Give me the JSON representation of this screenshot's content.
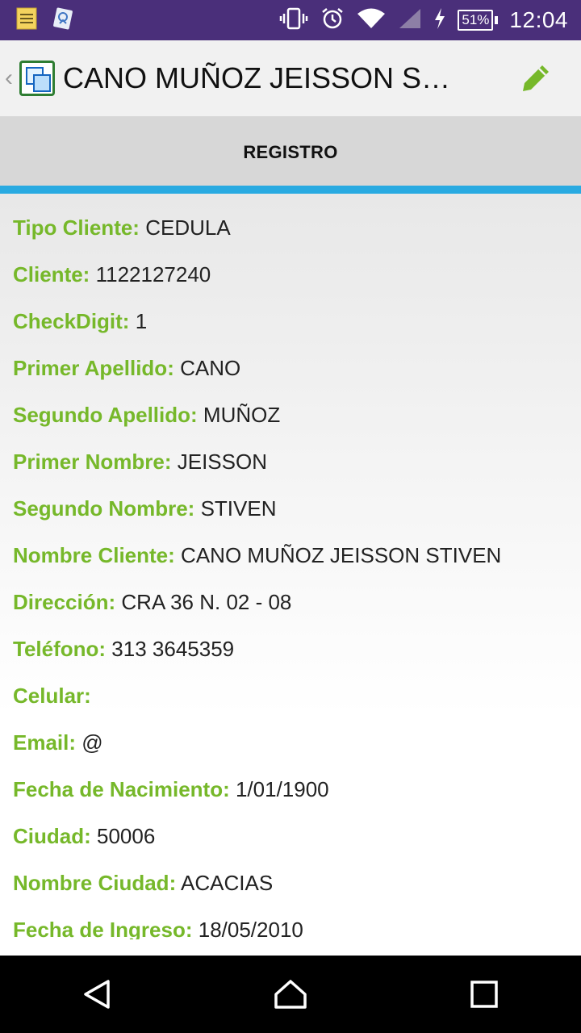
{
  "status_bar": {
    "battery": "51%",
    "time": "12:04",
    "icons": [
      "notes-icon",
      "gallery-icon",
      "vibrate-icon",
      "alarm-icon",
      "wifi-icon",
      "signal-icon",
      "charging-icon",
      "battery-icon"
    ]
  },
  "app_bar": {
    "back_symbol": "‹",
    "title": "CANO MUÑOZ JEISSON STIVEN",
    "edit_icon": "pencil-icon",
    "accent": "#76b82a"
  },
  "tab": {
    "label": "REGISTRO",
    "indicator_color": "#29aae1"
  },
  "fields": [
    {
      "label": "Tipo Cliente:",
      "value": "CEDULA"
    },
    {
      "label": "Cliente:",
      "value": "1122127240"
    },
    {
      "label": "CheckDigit:",
      "value": "1"
    },
    {
      "label": "Primer Apellido:",
      "value": "CANO"
    },
    {
      "label": "Segundo Apellido:",
      "value": "MUÑOZ"
    },
    {
      "label": "Primer Nombre:",
      "value": "JEISSON"
    },
    {
      "label": "Segundo Nombre:",
      "value": "STIVEN"
    },
    {
      "label": "Nombre Cliente:",
      "value": "CANO MUÑOZ JEISSON STIVEN"
    },
    {
      "label": "Dirección:",
      "value": "CRA 36 N. 02 - 08"
    },
    {
      "label": "Teléfono:",
      "value": "313 3645359"
    },
    {
      "label": "Celular:",
      "value": ""
    },
    {
      "label": "Email:",
      "value": "@"
    },
    {
      "label": "Fecha de Nacimiento:",
      "value": "1/01/1900"
    },
    {
      "label": "Ciudad:",
      "value": "50006"
    },
    {
      "label": "Nombre Ciudad:",
      "value": "ACACIAS"
    },
    {
      "label": "Fecha de Ingreso:",
      "value": "18/05/2010"
    }
  ],
  "nav_bar": {
    "icons": [
      "back-triangle-icon",
      "home-icon",
      "recents-icon"
    ]
  }
}
